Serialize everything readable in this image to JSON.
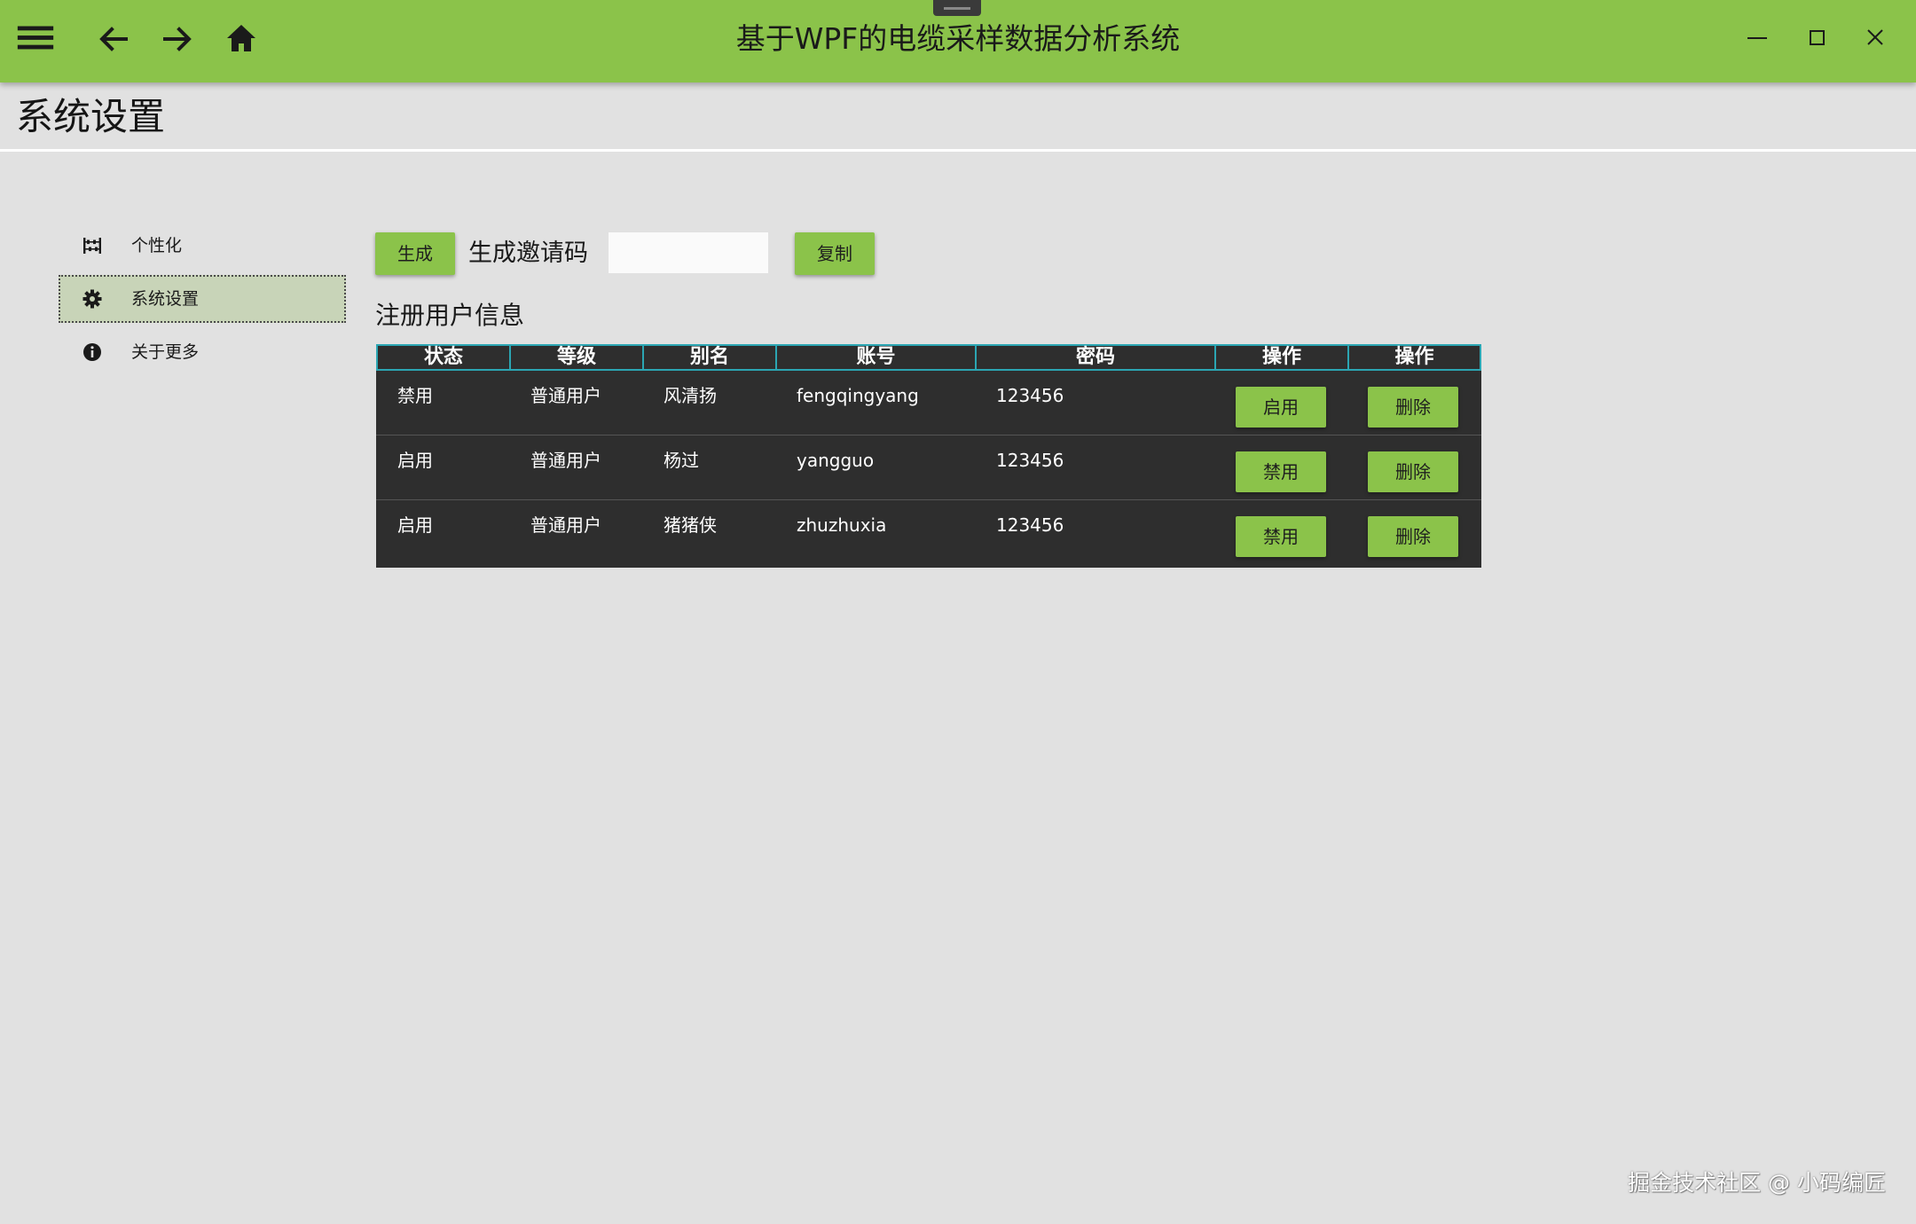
{
  "app": {
    "title": "基于WPF的电缆采样数据分析系统"
  },
  "page": {
    "title": "系统设置"
  },
  "sidebar": {
    "items": [
      {
        "label": "个性化",
        "icon": "abacus-icon"
      },
      {
        "label": "系统设置",
        "icon": "gear-icon",
        "active": true
      },
      {
        "label": "关于更多",
        "icon": "info-icon"
      }
    ]
  },
  "invite": {
    "generate_label": "生成",
    "label": "生成邀请码",
    "value": "",
    "copy_label": "复制"
  },
  "users": {
    "title": "注册用户信息",
    "columns": [
      "状态",
      "等级",
      "别名",
      "账号",
      "密码",
      "操作",
      "操作"
    ],
    "rows": [
      {
        "status": "禁用",
        "level": "普通用户",
        "alias": "风清扬",
        "account": "fengqingyang",
        "password": "123456",
        "toggle_label": "启用",
        "delete_label": "删除"
      },
      {
        "status": "启用",
        "level": "普通用户",
        "alias": "杨过",
        "account": "yangguo",
        "password": "123456",
        "toggle_label": "禁用",
        "delete_label": "删除"
      },
      {
        "status": "启用",
        "level": "普通用户",
        "alias": "猪猪侠",
        "account": "zhuzhuxia",
        "password": "123456",
        "toggle_label": "禁用",
        "delete_label": "删除"
      }
    ]
  },
  "watermark": "掘金技术社区 @ 小码编匠",
  "colors": {
    "accent": "#8bc34a",
    "table_bg": "#2e2e2e",
    "header_border": "#2ba6b3",
    "page_bg": "#e1e1e1"
  }
}
